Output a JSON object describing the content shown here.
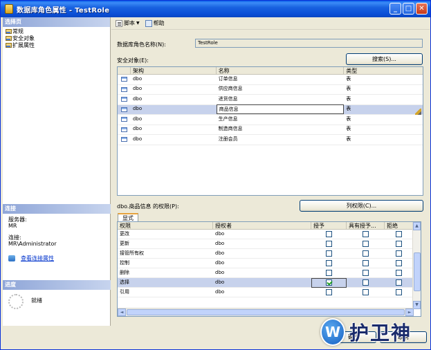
{
  "window": {
    "title": "数据库角色属性 - TestRole"
  },
  "title_buttons": {
    "minimize": "_",
    "maximize": "□",
    "close": "✕"
  },
  "sidebar": {
    "pages_header": "选择页",
    "items": [
      {
        "label": "常规",
        "icon": "page-icon"
      },
      {
        "label": "安全对象",
        "icon": "page-icon"
      },
      {
        "label": "扩展属性",
        "icon": "page-icon"
      }
    ],
    "connection": {
      "header": "连接",
      "server_label": "服务器:",
      "server_value": "MR",
      "conn_label": "连接:",
      "conn_value": "MR\\Administrator",
      "link_text": "查看连接属性"
    },
    "progress": {
      "header": "进度",
      "status": "就绪"
    }
  },
  "toolbar": {
    "script_label": "脚本",
    "help_label": "帮助"
  },
  "form": {
    "role_name_label": "数据库角色名称(N):",
    "role_name_value": "TestRole",
    "securables_label": "安全对象(E):",
    "search_button": "搜索(S)..."
  },
  "securables": {
    "columns": [
      "",
      "架构",
      "名称",
      "类型"
    ],
    "rows": [
      {
        "schema": "dbo",
        "name": "订单信息",
        "type": "表",
        "selected": false
      },
      {
        "schema": "dbo",
        "name": "供应商信息",
        "type": "表",
        "selected": false
      },
      {
        "schema": "dbo",
        "name": "进货信息",
        "type": "表",
        "selected": false
      },
      {
        "schema": "dbo",
        "name": "商品信息",
        "type": "表",
        "selected": true
      },
      {
        "schema": "dbo",
        "name": "生产信息",
        "type": "表",
        "selected": false
      },
      {
        "schema": "dbo",
        "name": "制造商信息",
        "type": "表",
        "selected": false
      },
      {
        "schema": "dbo",
        "name": "注册会员",
        "type": "表",
        "selected": false
      }
    ]
  },
  "permissions": {
    "label": "dbo.商品信息 的权限(P):",
    "column_perms_button": "列权限(C)...",
    "tab_label": "显式",
    "columns": [
      "权限",
      "授权者",
      "授予",
      "具有授予...",
      "拒绝"
    ],
    "rows": [
      {
        "permission": "更改",
        "grantor": "dbo",
        "grant": false,
        "with_grant": false,
        "deny": false,
        "selected": false
      },
      {
        "permission": "更新",
        "grantor": "dbo",
        "grant": false,
        "with_grant": false,
        "deny": false,
        "selected": false
      },
      {
        "permission": "接管所有权",
        "grantor": "dbo",
        "grant": false,
        "with_grant": false,
        "deny": false,
        "selected": false
      },
      {
        "permission": "控制",
        "grantor": "dbo",
        "grant": false,
        "with_grant": false,
        "deny": false,
        "selected": false
      },
      {
        "permission": "删除",
        "grantor": "dbo",
        "grant": false,
        "with_grant": false,
        "deny": false,
        "selected": false
      },
      {
        "permission": "选择",
        "grantor": "dbo",
        "grant": true,
        "with_grant": false,
        "deny": false,
        "selected": true
      },
      {
        "permission": "引用",
        "grantor": "dbo",
        "grant": false,
        "with_grant": false,
        "deny": false,
        "selected": false
      }
    ]
  },
  "buttons": {
    "ok": "确定",
    "cancel": "取消"
  },
  "watermark": {
    "text": "护卫神",
    "badge": "W"
  }
}
